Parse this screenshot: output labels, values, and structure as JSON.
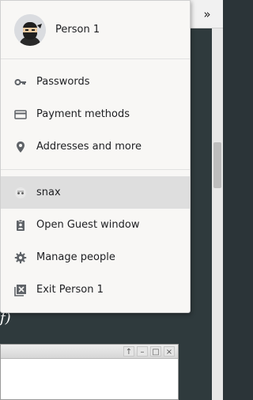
{
  "profile": {
    "name": "Person 1"
  },
  "menu": {
    "autofill_items": [
      {
        "label": "Passwords",
        "icon": "key-icon"
      },
      {
        "label": "Payment methods",
        "icon": "credit-card-icon"
      },
      {
        "label": "Addresses and more",
        "icon": "location-pin-icon"
      }
    ],
    "people_items": [
      {
        "label": "snax",
        "icon": "incognito-avatar-icon",
        "selected": true
      },
      {
        "label": "Open Guest window",
        "icon": "guest-badge-icon"
      },
      {
        "label": "Manage people",
        "icon": "gear-icon"
      },
      {
        "label": "Exit Person 1",
        "icon": "exit-icon"
      }
    ]
  },
  "background": {
    "chevron_glyph": "»",
    "italic_fragment": "f)",
    "window_controls": [
      "↑",
      "–",
      "□",
      "×"
    ]
  },
  "colors": {
    "menu_bg": "#f8f7f5",
    "selected_bg": "#dedede",
    "icon_color": "#5f6368",
    "page_bg_dark": "#2f3a3d"
  }
}
